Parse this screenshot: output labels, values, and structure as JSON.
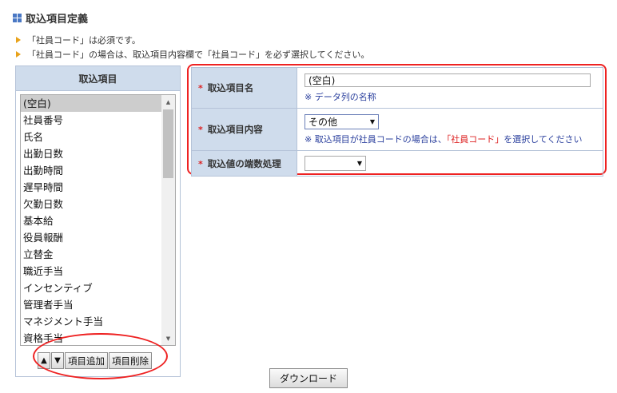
{
  "page": {
    "title": "取込項目定義",
    "notes": [
      "「社員コード」は必須です。",
      "「社員コード」の場合は、取込項目内容欄で「社員コード」を必ず選択してください。"
    ]
  },
  "item_list": {
    "header": "取込項目",
    "items": [
      "(空白)",
      "社員番号",
      "氏名",
      "出勤日数",
      "出勤時間",
      "遅早時間",
      "欠勤日数",
      "基本給",
      "役員報酬",
      "立替金",
      "職近手当",
      "インセンティブ",
      "管理者手当",
      "マネジメント手当",
      "資格手当"
    ],
    "selected_index": 0,
    "buttons": {
      "up": "▲",
      "down": "▼",
      "add": "項目追加",
      "delete": "項目削除"
    }
  },
  "form": {
    "required_mark": "*",
    "name": {
      "label": "取込項目名",
      "value": "(空白)",
      "hint": "※ データ列の名称"
    },
    "content": {
      "label": "取込項目内容",
      "selected": "その他",
      "hint_before": "※ 取込項目が社員コードの場合は、",
      "hint_highlight": "「社員コード」",
      "hint_after": "を選択してください"
    },
    "rounding": {
      "label": "取込値の端数処理",
      "selected": ""
    }
  },
  "download_button": "ダウンロード",
  "colors": {
    "accent_blue": "#4a78c4",
    "header_bg": "#cfdcec",
    "highlight_red": "#e22",
    "hint_blue": "#2a3f9d",
    "note_arrow": "#e8a21a"
  }
}
